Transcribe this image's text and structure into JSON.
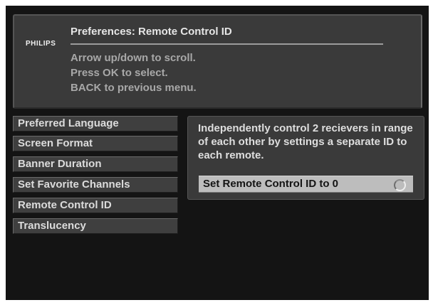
{
  "header": {
    "logo": "PHILIPS",
    "title": "Preferences: Remote Control ID",
    "instructions": [
      "Arrow up/down to scroll.",
      "Press OK to select.",
      "BACK to previous menu."
    ]
  },
  "menu": {
    "items": [
      "Preferred Language",
      "Screen Format",
      "Banner Duration",
      "Set Favorite Channels",
      "Remote Control ID",
      "Translucency"
    ],
    "selected": "Remote Control ID"
  },
  "info": {
    "description": "Independently control 2 recievers in range of each other by settings a separate ID to each remote.",
    "setting_label": "Set Remote Control ID to 0",
    "setting_checked": false
  }
}
